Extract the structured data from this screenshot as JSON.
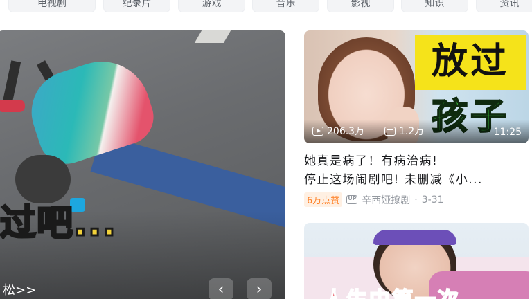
{
  "categories": [
    {
      "label": "电视剧",
      "active": false
    },
    {
      "label": "纪录片",
      "active": false
    },
    {
      "label": "游戏",
      "active": false
    },
    {
      "label": "音乐",
      "active": false
    },
    {
      "label": "影视",
      "active": false
    },
    {
      "label": "知识",
      "active": false
    },
    {
      "label": "资讯",
      "active": false
    }
  ],
  "hero": {
    "overlay_text": "过吧...",
    "caption": "松>>",
    "prev_glyph": "‹",
    "next_glyph": "›"
  },
  "cards": [
    {
      "thumb_text_1": "放过",
      "thumb_text_2": "孩子",
      "views": "206.3万",
      "danmaku": "1.2万",
      "duration": "11:25",
      "title_line_1": "她真是病了！有病治病!",
      "title_line_2": "停止这场闹剧吧! 未删减《小...",
      "badge": "6万点赞",
      "author": "辛西娅撩剧",
      "separator": "·",
      "date": "3-31",
      "colors": {
        "badge_bg": "#fff0e3",
        "badge_text": "#ff7f24",
        "yellow": "#f5e31a",
        "green": "#3ccd3f"
      }
    },
    {
      "thumb_caption": "人生中第一次",
      "colors": {
        "caption": "#e01d2b"
      }
    }
  ]
}
